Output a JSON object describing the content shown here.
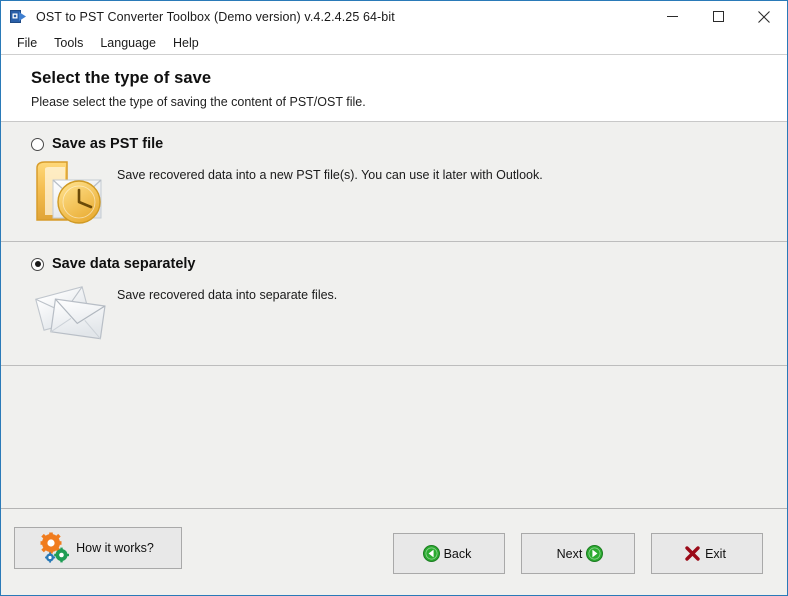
{
  "window": {
    "title": "OST to PST Converter Toolbox (Demo version) v.4.2.4.25 64-bit",
    "app_icon": "ost-pst-converter-icon",
    "border_color": "#2a7ab8",
    "controls": {
      "minimize": "minimize-button",
      "maximize": "maximize-button",
      "close": "close-button"
    }
  },
  "menu": {
    "items": [
      {
        "label": "File"
      },
      {
        "label": "Tools"
      },
      {
        "label": "Language"
      },
      {
        "label": "Help"
      }
    ]
  },
  "header": {
    "title": "Select the type of save",
    "subtitle": "Please select the type of saving the content of PST/OST file."
  },
  "options": [
    {
      "id": "save-as-pst",
      "label": "Save as PST file",
      "description": "Save recovered data into a new PST file(s). You can use it later with Outlook.",
      "selected": false,
      "icon": "outlook-folder-icon"
    },
    {
      "id": "save-data-separately",
      "label": "Save data separately",
      "description": "Save recovered data into separate files.",
      "selected": true,
      "icon": "envelopes-icon"
    }
  ],
  "footer": {
    "how_it_works": {
      "label": "How it works?",
      "icon": "gears-icon"
    },
    "back": {
      "label": "Back",
      "icon": "arrow-left-circle-icon"
    },
    "next": {
      "label": "Next",
      "icon": "arrow-right-circle-icon"
    },
    "exit": {
      "label": "Exit",
      "icon": "red-x-icon"
    }
  },
  "colors": {
    "accent_blue": "#2a7ab8",
    "gear_orange": "#f07c1e",
    "gear_green": "#1f9d55",
    "gear_blue": "#2a7ab8",
    "nav_green": "#2bab30",
    "exit_red": "#9b0a18",
    "panel_bg": "#f0f0ee"
  }
}
